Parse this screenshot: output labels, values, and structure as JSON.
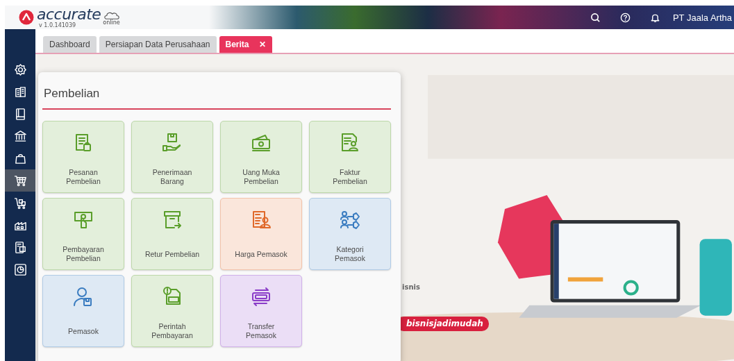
{
  "header": {
    "logo": "accurate",
    "logo_sub": "online",
    "version": "v 1.0.141039",
    "company": "PT Jaala Artha"
  },
  "sidebar": {
    "items": [
      {
        "selected": false
      },
      {
        "selected": false
      },
      {
        "selected": false
      },
      {
        "selected": false
      },
      {
        "selected": false
      },
      {
        "selected": true
      },
      {
        "selected": false
      },
      {
        "selected": false
      },
      {
        "selected": false
      },
      {
        "selected": false
      }
    ]
  },
  "tabs": [
    {
      "label": "Dashboard",
      "selected": false
    },
    {
      "label": "Persiapan Data Perusahaan",
      "selected": false
    },
    {
      "label": "Berita",
      "selected": true,
      "close": "✕"
    }
  ],
  "banner": {
    "kind": "picture",
    "caption": "isnis",
    "hashtag": "bisnisjadimudah"
  },
  "panel": {
    "title": "Pembelian",
    "tiles": [
      {
        "label": "Pesanan\nPembelian",
        "color": "#5a9e2a"
      },
      {
        "label": "Penerimaan\nBarang",
        "color": "#5a9e2a"
      },
      {
        "label": "Uang Muka\nPembelian",
        "color": "#5a9e2a"
      },
      {
        "label": "Faktur\nPembelian",
        "color": "#5a9e2a"
      },
      {
        "label": "Pembayaran\nPembelian",
        "color": "#5a9e2a"
      },
      {
        "label": "Retur Pembelian",
        "color": "#5a9e2a"
      },
      {
        "label": "Harga Pemasok",
        "color": "#e0692a"
      },
      {
        "label": "Kategori\nPemasok",
        "color": "#3a7cc0"
      },
      {
        "label": "Pemasok",
        "color": "#3a7cc0"
      },
      {
        "label": "Perintah\nPembayaran",
        "color": "#5a9e2a"
      },
      {
        "label": "Transfer\nPemasok",
        "color": "#8a3cc8"
      }
    ]
  }
}
